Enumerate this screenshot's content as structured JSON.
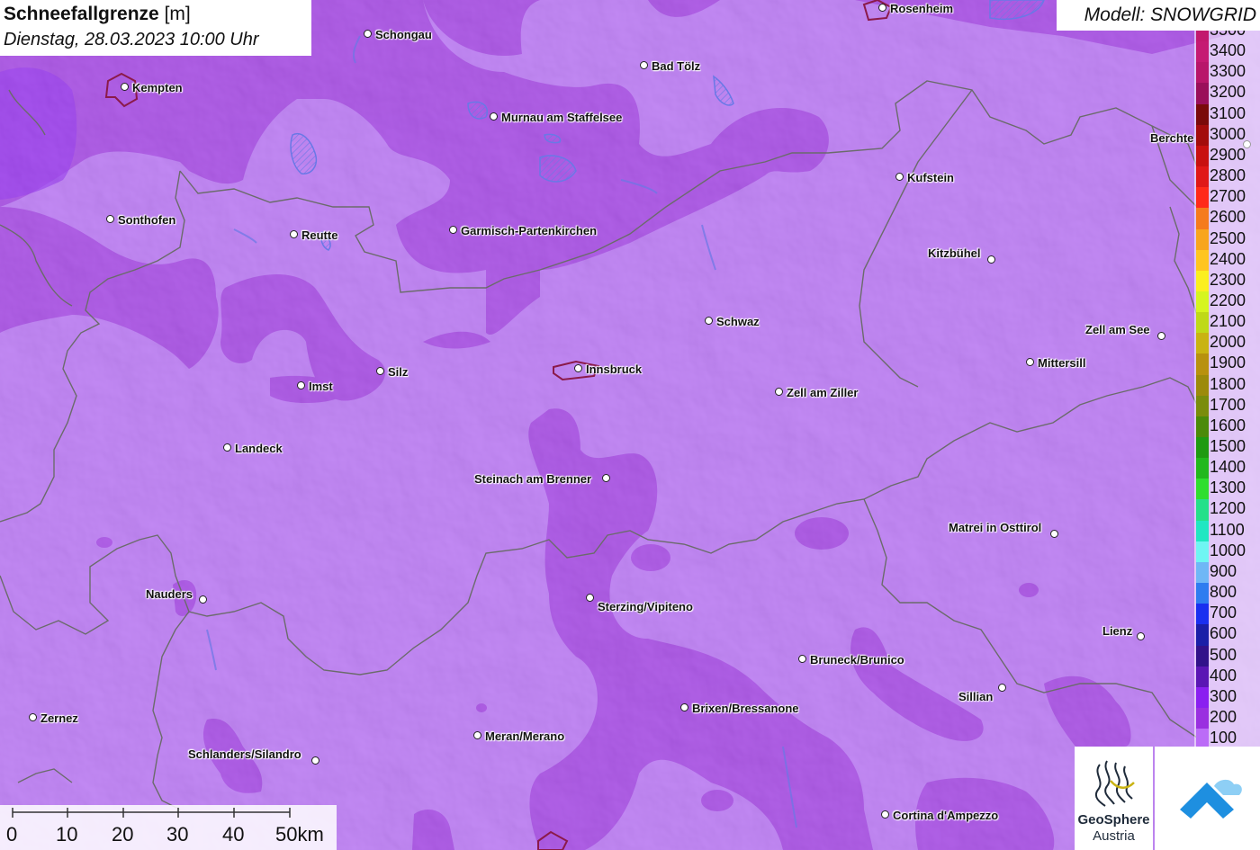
{
  "title": {
    "main": "Schneefallgrenze",
    "unit": "[m]",
    "datetime": "Dienstag, 28.03.2023 10:00 Uhr"
  },
  "model": "Modell: SNOWGRID",
  "cities": [
    {
      "name": "Rosenheim"
    },
    {
      "name": "Schongau"
    },
    {
      "name": "Kempten"
    },
    {
      "name": "Bad Tölz"
    },
    {
      "name": "Murnau am Staffelsee"
    },
    {
      "name": "Berchte"
    },
    {
      "name": "Kufstein"
    },
    {
      "name": "Sonthofen"
    },
    {
      "name": "Reutte"
    },
    {
      "name": "Garmisch-Partenkirchen"
    },
    {
      "name": "Kitzbühel"
    },
    {
      "name": "Schwaz"
    },
    {
      "name": "Zell am See"
    },
    {
      "name": "Mittersill"
    },
    {
      "name": "Innsbruck"
    },
    {
      "name": "Silz"
    },
    {
      "name": "Imst"
    },
    {
      "name": "Zell am Ziller"
    },
    {
      "name": "Landeck"
    },
    {
      "name": "Steinach am Brenner"
    },
    {
      "name": "Matrei in Osttirol"
    },
    {
      "name": "Nauders"
    },
    {
      "name": "Sterzing/Vipiteno"
    },
    {
      "name": "Lienz"
    },
    {
      "name": "Bruneck/Brunico"
    },
    {
      "name": "Sillian"
    },
    {
      "name": "Brixen/Bressanone"
    },
    {
      "name": "Zernez"
    },
    {
      "name": "Meran/Merano"
    },
    {
      "name": "Schlanders/Silandro"
    },
    {
      "name": "Cortina d'Ampezzo"
    }
  ],
  "scale": {
    "labels": [
      "0",
      "10",
      "20",
      "30",
      "40",
      "50km"
    ]
  },
  "legend": [
    {
      "value": "3500",
      "color": "#c2186e"
    },
    {
      "value": "3400",
      "color": "#c51a73"
    },
    {
      "value": "3300",
      "color": "#b8166a"
    },
    {
      "value": "3200",
      "color": "#9a0f5a"
    },
    {
      "value": "3100",
      "color": "#7a0a0a"
    },
    {
      "value": "3000",
      "color": "#a30c0c"
    },
    {
      "value": "2900",
      "color": "#c81010"
    },
    {
      "value": "2800",
      "color": "#e01818"
    },
    {
      "value": "2700",
      "color": "#ff2a1a"
    },
    {
      "value": "2600",
      "color": "#f57b1d"
    },
    {
      "value": "2500",
      "color": "#f8a51e"
    },
    {
      "value": "2400",
      "color": "#ffc51f"
    },
    {
      "value": "2300",
      "color": "#fbef1f"
    },
    {
      "value": "2200",
      "color": "#d6f51f"
    },
    {
      "value": "2100",
      "color": "#bfd918"
    },
    {
      "value": "2000",
      "color": "#c9b312"
    },
    {
      "value": "1900",
      "color": "#b8910e"
    },
    {
      "value": "1800",
      "color": "#9c8a0b"
    },
    {
      "value": "1700",
      "color": "#7a8c0c"
    },
    {
      "value": "1600",
      "color": "#4b8a0a"
    },
    {
      "value": "1500",
      "color": "#1f9a12"
    },
    {
      "value": "1400",
      "color": "#22b81d"
    },
    {
      "value": "1300",
      "color": "#2fde2f"
    },
    {
      "value": "1200",
      "color": "#25e08a"
    },
    {
      "value": "1100",
      "color": "#20e7c2"
    },
    {
      "value": "1000",
      "color": "#6ff5f3"
    },
    {
      "value": "900",
      "color": "#6fb7f6"
    },
    {
      "value": "800",
      "color": "#2f7cf0"
    },
    {
      "value": "700",
      "color": "#1a2ff0"
    },
    {
      "value": "600",
      "color": "#1b1fa8"
    },
    {
      "value": "500",
      "color": "#32128a"
    },
    {
      "value": "400",
      "color": "#5b16b4"
    },
    {
      "value": "300",
      "color": "#8a1ff0"
    },
    {
      "value": "200",
      "color": "#9a2fe0"
    },
    {
      "value": "100",
      "color": "#bb6bf7"
    }
  ],
  "logos": {
    "geosphere_line1": "GeoSphere",
    "geosphere_line2": "Austria",
    "app_icon": "snowgrid-app-icon"
  },
  "colors": {
    "background_snowline_100": "#b56cf5",
    "snowline_200": "#9a2fe0"
  }
}
